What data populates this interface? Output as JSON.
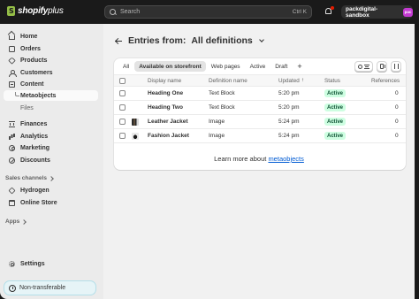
{
  "topbar": {
    "logo_text": "shopify",
    "logo_plus": "plus",
    "search_placeholder": "Search",
    "search_shortcut": "Ctrl K",
    "store_name": "packdigital-sandbox",
    "store_avatar": "pac"
  },
  "sidebar": {
    "items": [
      {
        "label": "Home",
        "icon": "home-icon"
      },
      {
        "label": "Orders",
        "icon": "orders-icon"
      },
      {
        "label": "Products",
        "icon": "tag-icon"
      },
      {
        "label": "Customers",
        "icon": "person-icon"
      },
      {
        "label": "Content",
        "icon": "content-icon"
      },
      {
        "label": "Metaobjects",
        "icon": "return-icon"
      },
      {
        "label": "Files"
      },
      {
        "label": "Finances",
        "icon": "bank-icon"
      },
      {
        "label": "Analytics",
        "icon": "chart-icon"
      },
      {
        "label": "Marketing",
        "icon": "target-icon"
      },
      {
        "label": "Discounts",
        "icon": "discount-icon"
      }
    ],
    "sales_channels_label": "Sales channels",
    "sales_channels": [
      {
        "label": "Hydrogen",
        "icon": "hydrogen-icon"
      },
      {
        "label": "Online Store",
        "icon": "store-icon"
      }
    ],
    "apps_label": "Apps",
    "settings_label": "Settings",
    "nontransferable_label": "Non-transferable"
  },
  "main": {
    "title_prefix": "Entries from:",
    "title_value": "All definitions",
    "tabs": [
      "All",
      "Available on storefront",
      "Web pages",
      "Active",
      "Draft"
    ],
    "add_tab": "+",
    "columns": {
      "display_name": "Display name",
      "definition_name": "Definition name",
      "updated": "Updated",
      "status": "Status",
      "references": "References"
    },
    "rows": [
      {
        "display_name": "Heading One",
        "definition_name": "Text Block",
        "updated": "5:20 pm",
        "status": "Active",
        "references": "0",
        "thumb": ""
      },
      {
        "display_name": "Heading Two",
        "definition_name": "Text Block",
        "updated": "5:20 pm",
        "status": "Active",
        "references": "0",
        "thumb": ""
      },
      {
        "display_name": "Leather Jacket",
        "definition_name": "Image",
        "updated": "5:24 pm",
        "status": "Active",
        "references": "0",
        "thumb": "leather-jacket-thumbnail"
      },
      {
        "display_name": "Fashion Jacket",
        "definition_name": "Image",
        "updated": "5:24 pm",
        "status": "Active",
        "references": "0",
        "thumb": "fashion-jacket-thumbnail"
      }
    ],
    "learn_more_prefix": "Learn more about",
    "learn_more_link": "metaobjects"
  },
  "colors": {
    "topbar_bg": "#1a1a1a",
    "sidebar_bg": "#ebebeb",
    "main_bg": "#f1f1f1",
    "active_badge_bg": "#cdfee1",
    "active_badge_text": "#0c5132",
    "link": "#005bd3",
    "logo_green": "#95bf47"
  }
}
